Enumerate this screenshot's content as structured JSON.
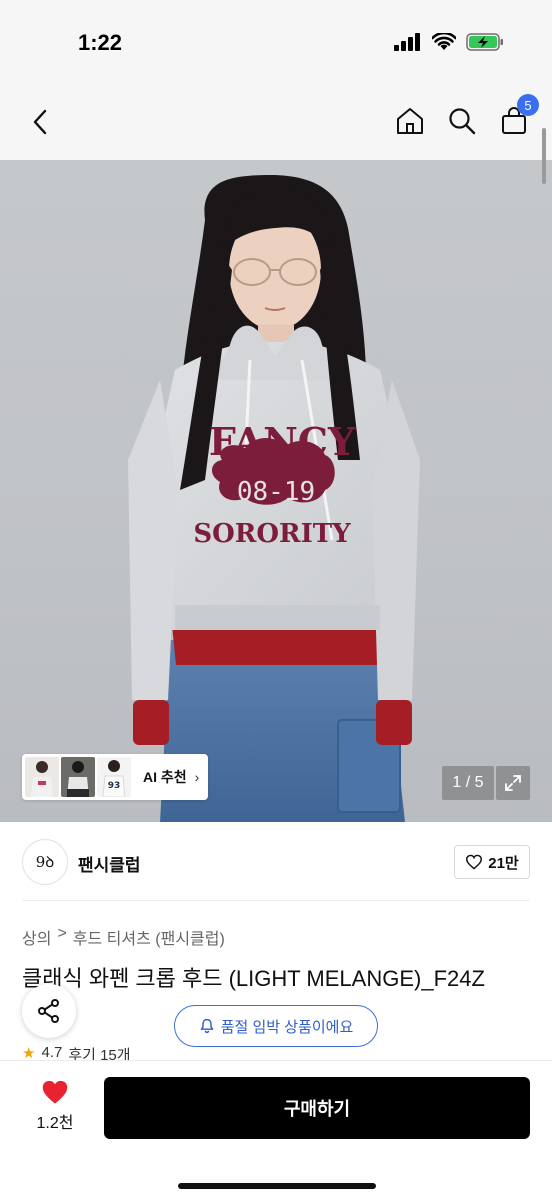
{
  "status_bar": {
    "time": "1:22"
  },
  "nav": {
    "cart_count": "5"
  },
  "hero": {
    "counter": "1 / 5",
    "ai_label": "AI 추천",
    "print_top": "FANCY",
    "print_patch": "08-19",
    "print_bottom": "SORORITY"
  },
  "brand": {
    "name": "팬시클럽",
    "logo_text": "9ꝺ",
    "likes": "21만"
  },
  "breadcrumb": {
    "level1": "상의",
    "sep": ">",
    "level2": "후드 티셔츠 (팬시클럽)"
  },
  "product": {
    "title": "클래식 와펜 크롭 후드 (LIGHT MELANGE)_F24Z",
    "rating": "4.7",
    "reviews": "후기 15개"
  },
  "stock_notice": "품절 임박 상품이에요",
  "bottom": {
    "wish_count": "1.2천",
    "buy_label": "구매하기"
  },
  "colors": {
    "accent_blue": "#3d6fd6",
    "heart_red": "#e8232f",
    "buy_black": "#000000"
  }
}
